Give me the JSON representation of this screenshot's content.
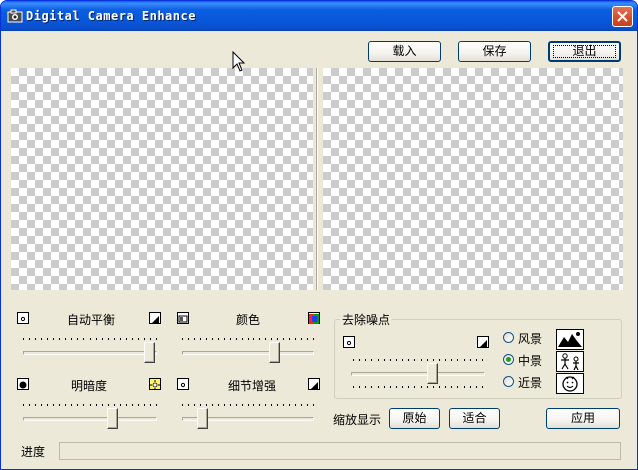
{
  "window": {
    "title": "Digital Camera Enhance"
  },
  "toolbar": {
    "load_label": "载入",
    "save_label": "保存",
    "exit_label": "退出"
  },
  "adjustments": {
    "auto_balance": {
      "label": "自动平衡",
      "value": 0.98
    },
    "color": {
      "label": "颜色",
      "value": 0.72
    },
    "brightness": {
      "label": "明暗度",
      "value": 0.68
    },
    "detail_enhance": {
      "label": "细节增强",
      "value": 0.12
    }
  },
  "denoise": {
    "title": "去除噪点",
    "value": 0.62,
    "options": [
      {
        "label": "风景",
        "selected": false,
        "icon": "landscape-icon"
      },
      {
        "label": "中景",
        "selected": true,
        "icon": "people-icon"
      },
      {
        "label": "近景",
        "selected": false,
        "icon": "face-icon"
      }
    ]
  },
  "zoom": {
    "label": "缩放显示",
    "original_label": "原始",
    "fit_label": "适合"
  },
  "apply_label": "应用",
  "progress": {
    "label": "进度",
    "value": 0
  },
  "colors": {
    "titlebar": "#0A5FEF",
    "window_bg": "#ECE9D8",
    "button_border": "#003C74",
    "radio_dot": "#21A121"
  }
}
